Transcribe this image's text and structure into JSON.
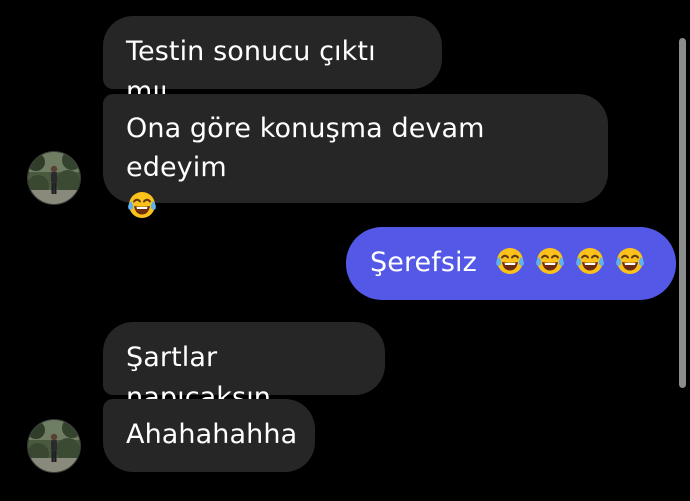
{
  "messages": [
    {
      "direction": "incoming",
      "text": "Testin sonucu çıktı mıı"
    },
    {
      "direction": "incoming",
      "text": "Ona göre konuşma devam edeyim",
      "emojis": [
        "tears-of-joy"
      ]
    },
    {
      "direction": "outgoing",
      "text": "Şerefsiz",
      "emojis": [
        "tears-of-joy",
        "tears-of-joy",
        "tears-of-joy",
        "tears-of-joy"
      ]
    },
    {
      "direction": "incoming",
      "text": "Şartlar napıcaksın"
    },
    {
      "direction": "incoming",
      "text": "Ahahahahha"
    }
  ],
  "colors": {
    "background": "#000000",
    "incoming_bubble": "#262626",
    "outgoing_bubble": "#5458e6",
    "text": "#ffffff",
    "scrollbar": "#8c8c8c"
  },
  "icons": {
    "emoji": "face-with-tears-of-joy-icon",
    "avatar": "contact-avatar"
  }
}
